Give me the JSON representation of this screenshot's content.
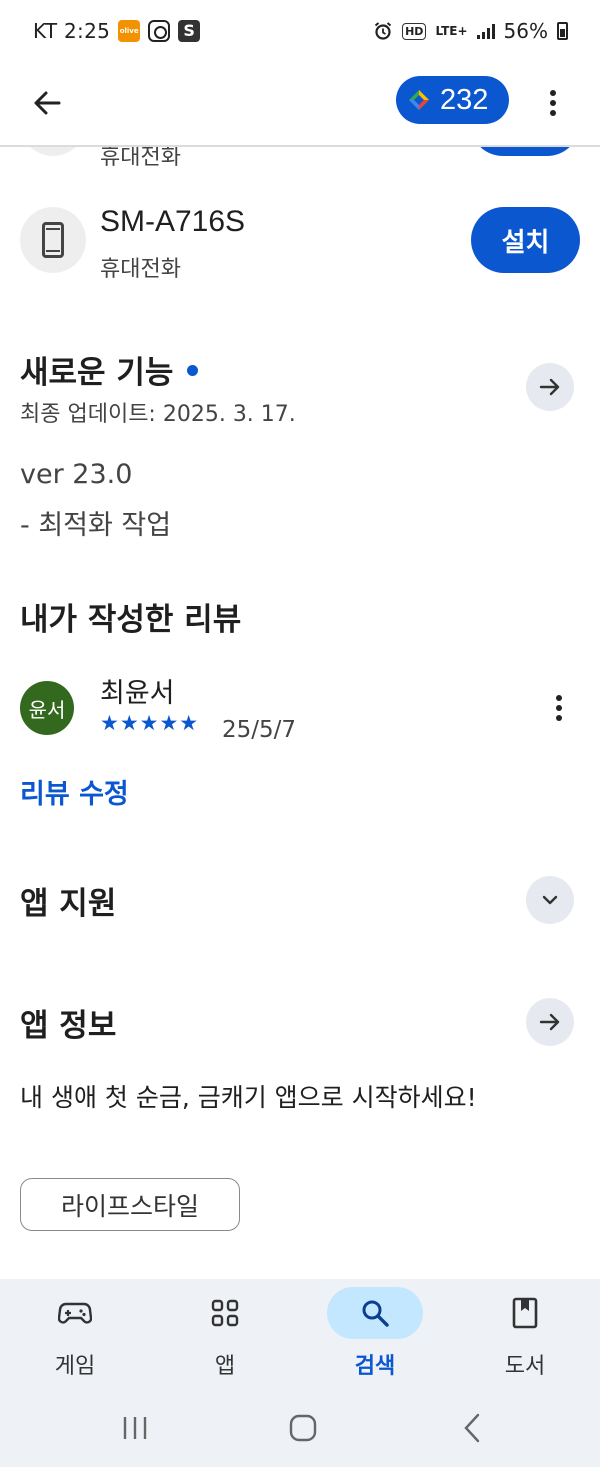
{
  "status_bar": {
    "carrier_time": "KT 2:25",
    "notif_orange_text": "올리브TEMU",
    "notif_s": "S",
    "lte": "LTE+",
    "hd": "HD",
    "battery": "56%"
  },
  "app_bar": {
    "points": "232"
  },
  "devices": {
    "hidden_device_type": "휴대전화",
    "model": "SM-A716S",
    "type": "휴대전화",
    "install_label": "설치"
  },
  "whats_new": {
    "title": "새로운 기능",
    "last_update": "최종 업데이트: 2025. 3. 17.",
    "version": "ver 23.0",
    "changes": "- 최적화 작업"
  },
  "my_review": {
    "title": "내가 작성한 리뷰",
    "avatar_text": "윤서",
    "reviewer": "최윤서",
    "stars": "★★★★★",
    "rating": 5,
    "date": "25/5/7",
    "edit_label": "리뷰 수정"
  },
  "app_support": {
    "title": "앱 지원"
  },
  "about": {
    "title": "앱 정보",
    "description": "내 생애 첫 순금, 금캐기 앱으로 시작하세요!",
    "category_tag": "라이프스타일"
  },
  "bottom_nav": {
    "items": [
      {
        "label": "게임",
        "icon": "gamepad-icon",
        "active": false
      },
      {
        "label": "앱",
        "icon": "apps-grid-icon",
        "active": false
      },
      {
        "label": "검색",
        "icon": "search-icon",
        "active": true
      },
      {
        "label": "도서",
        "icon": "book-icon",
        "active": false
      }
    ]
  },
  "colors": {
    "accent": "#0b57d0",
    "active_pill": "#c2e7ff",
    "avatar": "#33691e",
    "nav_bg": "#eef1f6"
  }
}
